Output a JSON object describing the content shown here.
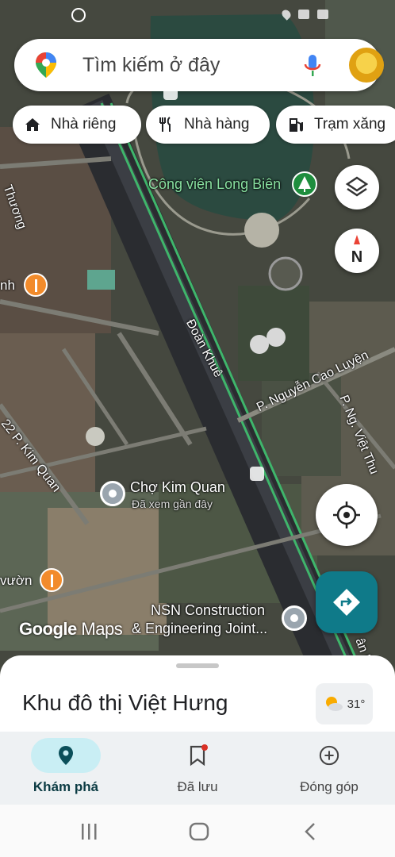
{
  "search": {
    "placeholder": "Tìm kiếm ở đây"
  },
  "chips": [
    {
      "label": "Nhà riêng",
      "icon": "home-icon"
    },
    {
      "label": "Nhà hàng",
      "icon": "restaurant-icon"
    },
    {
      "label": "Trạm xăng",
      "icon": "gas-station-icon"
    }
  ],
  "map": {
    "park_label": "Công viên Long Biên",
    "roads": {
      "doan_khue": "Đoàn Khuê",
      "nguyen_cao_luyen": "P. Nguyễn Cao Luyện",
      "ng_viet_thu": "P. Ng. Việt Thu",
      "kim_quan": "22 P. Kim Quan",
      "thuong": "Thương"
    },
    "left_nh": "nh",
    "left_vuon": "vườn",
    "right_edge_label": "ân K",
    "market": {
      "name": "Chợ Kim Quan",
      "sub": "Đã xem gần đây"
    },
    "company": {
      "line1": "NSN Construction",
      "line2": "& Engineering Joint..."
    },
    "compass_letter": "N",
    "logo_google": "Google",
    "logo_maps": "Maps"
  },
  "sheet": {
    "title": "Khu đô thị Việt Hưng",
    "weather": "31°"
  },
  "nav": [
    {
      "label": "Khám phá",
      "icon": "explore-pin-icon",
      "active": true
    },
    {
      "label": "Đã lưu",
      "icon": "bookmark-icon",
      "active": false
    },
    {
      "label": "Đóng góp",
      "icon": "add-circle-icon",
      "active": false
    }
  ],
  "colors": {
    "accent": "#0f7a89",
    "active_pill": "#c9eef4",
    "poi_orange": "#f28b2b",
    "park_green": "#88e0a0"
  }
}
